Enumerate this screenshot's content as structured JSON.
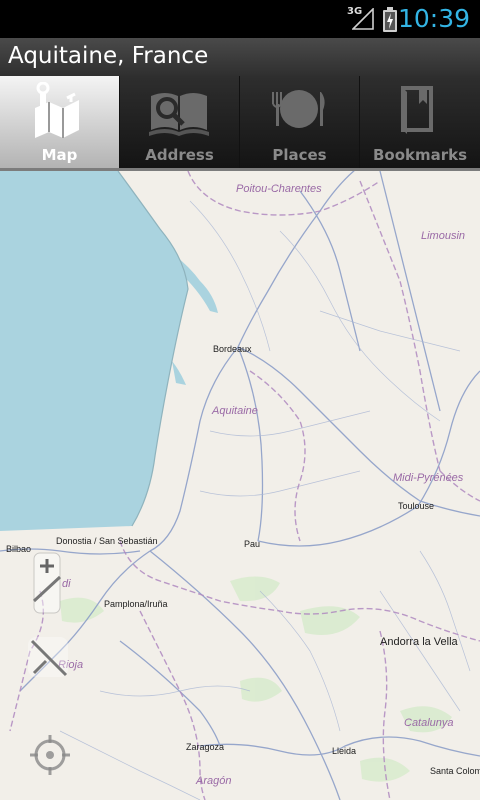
{
  "status": {
    "network": "3G",
    "time": "10:39"
  },
  "titlebar": {
    "title": "Aquitaine, France"
  },
  "tabs": [
    {
      "label": "Map",
      "icon": "map-icon",
      "active": true
    },
    {
      "label": "Address",
      "icon": "address-book-icon",
      "active": false
    },
    {
      "label": "Places",
      "icon": "places-dining-icon",
      "active": false
    },
    {
      "label": "Bookmarks",
      "icon": "bookmark-icon",
      "active": false
    }
  ],
  "map": {
    "labels": {
      "poitou": "Poitou-Charentes",
      "limousin": "Limousin",
      "bordeaux": "Bordeaux",
      "aquitaine": "Aquitaine",
      "midi": "Midi-Pyrénées",
      "toulouse": "Toulouse",
      "bilbao": "Bilbao",
      "donostia": "Donostia / San Sebastián",
      "pau": "Pau",
      "pamplona": "Pamplona/Iruña",
      "andorra": "Andorra la Vella",
      "rioja": "Rioja",
      "nsdi": "di",
      "catalunya": "Catalunya",
      "zaragoza": "Zaragoza",
      "lleida": "Lleida",
      "aragon": "Aragón",
      "santacoloma": "Santa Colom"
    },
    "controls": {
      "zoom_in": "+",
      "zoom_out": "-"
    }
  },
  "colors": {
    "status_clock": "#33b5e5",
    "sea": "#aad3df",
    "land": "#f2efe9",
    "admin_border": "#b08ac0",
    "road": "#8d9fc8",
    "region_label": "#9a6aa6"
  }
}
